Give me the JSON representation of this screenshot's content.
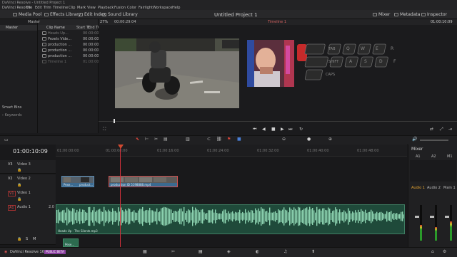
{
  "app": {
    "window_title": "DaVinci Resolve - Untitled Project 1",
    "project_title": "Untitled Project 1",
    "footer_name": "DaVinci Resolve 16",
    "footer_badge": "PUBLIC BETA"
  },
  "menu": [
    "DaVinci Resolve",
    "File",
    "Edit",
    "Trim",
    "Timeline",
    "Clip",
    "Mark",
    "View",
    "Playback",
    "Fusion",
    "Color",
    "Fairlight",
    "Workspace",
    "Help"
  ],
  "toolbar": {
    "media_pool": "Media Pool",
    "effects_library": "Effects Library",
    "edit_index": "Edit Index",
    "sound_library": "Sound Library",
    "mixer": "Mixer",
    "metadata": "Metadata",
    "inspector": "Inspector"
  },
  "media_pool": {
    "bin": "Master",
    "master": "Master",
    "smart_bins": "Smart Bins",
    "keywords": "Keywords",
    "columns": [
      "Clip Name",
      "Start TC",
      "End TC"
    ],
    "clips": [
      {
        "name": "Heads Up...",
        "start": "00:00:00",
        "end": ""
      },
      {
        "name": "Pexels Vide...",
        "start": "00:00:00",
        "end": ""
      },
      {
        "name": "production ...",
        "start": "00:00:00",
        "end": ""
      },
      {
        "name": "production ...",
        "start": "00:00:00",
        "end": ""
      },
      {
        "name": "production ...",
        "start": "00:00:00",
        "end": ""
      },
      {
        "name": "Timeline 1",
        "start": "01:00:00",
        "end": ""
      }
    ]
  },
  "viewer": {
    "zoom": "27%",
    "source_tc": "00:00:29:04",
    "timeline_name": "Timeline 1",
    "record_tc": "01:00:10:09",
    "keys_row1": [
      "TAB",
      "Q",
      "W",
      "E",
      "R"
    ],
    "keys_row2": [
      "SHIFT",
      "A",
      "S",
      "D",
      "F"
    ],
    "keys_row3": [
      "CAPS"
    ]
  },
  "timeline": {
    "timecode": "01:00:10:09",
    "ruler": [
      "01:00:00:00",
      "01:00:08:00",
      "01:00:16:00",
      "01:00:24:00",
      "01:00:32:00",
      "01:00:40:00",
      "01:00:48:00",
      "01:00:56:00"
    ],
    "tracks": [
      {
        "id": "V3",
        "name": "Video 3"
      },
      {
        "id": "V2",
        "name": "Video 2"
      },
      {
        "id": "V1",
        "name": "Video 1"
      },
      {
        "id": "A1",
        "name": "Audio 1",
        "level": "2.0"
      }
    ],
    "clips": {
      "v2_a": "Pexe...",
      "v2_b": "product...",
      "v2_c": "production ID 5198888.mp4",
      "a1": "Heads Up - The Silents.mp3",
      "v1_small": "Pexe..."
    }
  },
  "mixer": {
    "title": "Mixer",
    "channels": [
      "A1",
      "A2",
      "M1"
    ],
    "buses": [
      "Audio 1",
      "Audio 2",
      "Main 1"
    ],
    "meter_levels": [
      0.45,
      0.38,
      0.55
    ]
  }
}
